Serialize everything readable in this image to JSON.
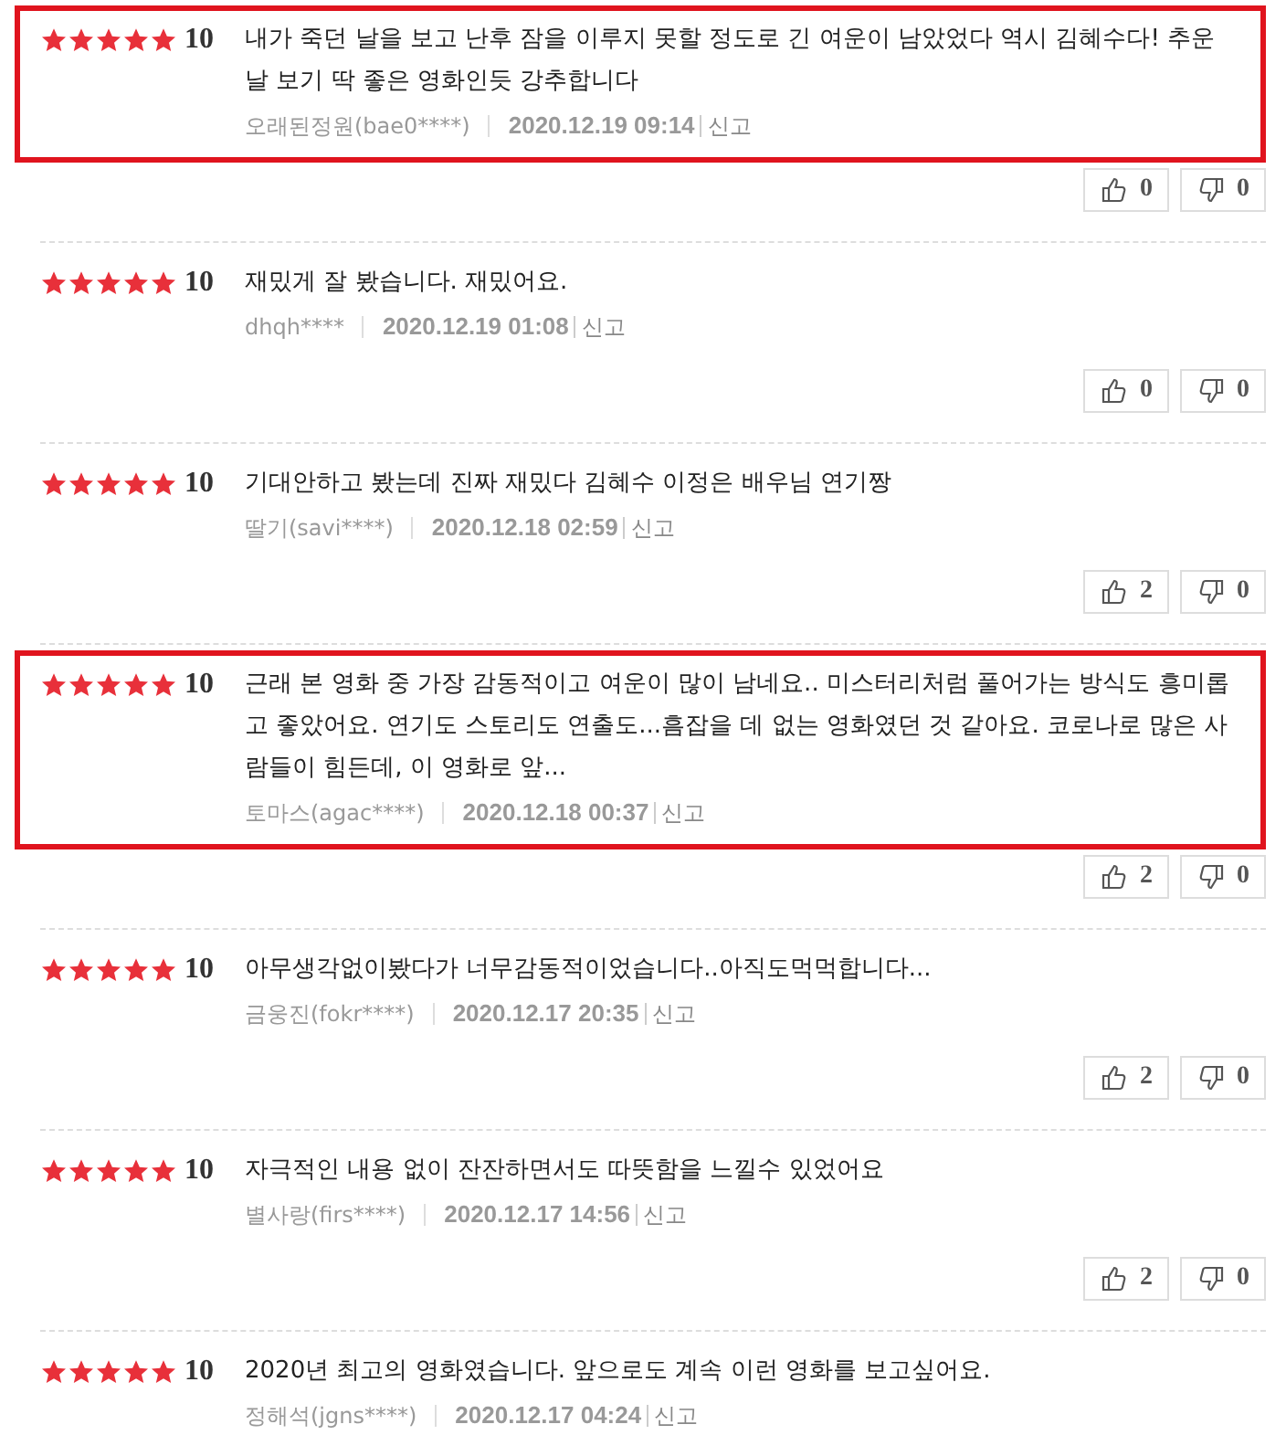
{
  "reviews": [
    {
      "highlighted": true,
      "stars": 5,
      "score": "10",
      "text": "내가 죽던 날을 보고 난후 잠을 이루지 못할 정도로 긴 여운이 남았었다 역시 김혜수다! 추운 날 보기 딱 좋은 영화인듯 강추합니다",
      "author": "오래된정원(bae0****)",
      "date": "2020.12.19 09:14",
      "report": "신고",
      "likes": "0",
      "dislikes": "0"
    },
    {
      "highlighted": false,
      "stars": 5,
      "score": "10",
      "text": "재밌게 잘 봤습니다. 재밌어요.",
      "author": "dhqh****",
      "date": "2020.12.19 01:08",
      "report": "신고",
      "likes": "0",
      "dislikes": "0"
    },
    {
      "highlighted": false,
      "stars": 5,
      "score": "10",
      "text": "기대안하고 봤는데 진짜 재밌다 김혜수 이정은 배우님 연기짱",
      "author": "딸기(savi****)",
      "date": "2020.12.18 02:59",
      "report": "신고",
      "likes": "2",
      "dislikes": "0"
    },
    {
      "highlighted": true,
      "stars": 5,
      "score": "10",
      "text": "근래 본 영화 중 가장 감동적이고 여운이 많이 남네요.. 미스터리처럼 풀어가는 방식도 흥미롭고 좋았어요. 연기도 스토리도 연출도...흠잡을 데 없는 영화였던 것 같아요. 코로나로 많은 사람들이 힘든데, 이 영화로 앞...",
      "author": "토마스(agac****)",
      "date": "2020.12.18 00:37",
      "report": "신고",
      "likes": "2",
      "dislikes": "0"
    },
    {
      "highlighted": false,
      "stars": 5,
      "score": "10",
      "text": "아무생각없이봤다가 너무감동적이었습니다..아직도먹먹합니다...",
      "author": "금웅진(fokr****)",
      "date": "2020.12.17 20:35",
      "report": "신고",
      "likes": "2",
      "dislikes": "0"
    },
    {
      "highlighted": false,
      "stars": 5,
      "score": "10",
      "text": "자극적인 내용 없이 잔잔하면서도 따뜻함을 느낄수 있었어요",
      "author": "별사랑(firs****)",
      "date": "2020.12.17 14:56",
      "report": "신고",
      "likes": "2",
      "dislikes": "0"
    },
    {
      "highlighted": false,
      "stars": 5,
      "score": "10",
      "text": "2020년 최고의 영화였습니다. 앞으로도 계속 이런 영화를 보고싶어요.",
      "author": "정해석(jgns****)",
      "date": "2020.12.17 04:24",
      "report": "신고"
    }
  ]
}
